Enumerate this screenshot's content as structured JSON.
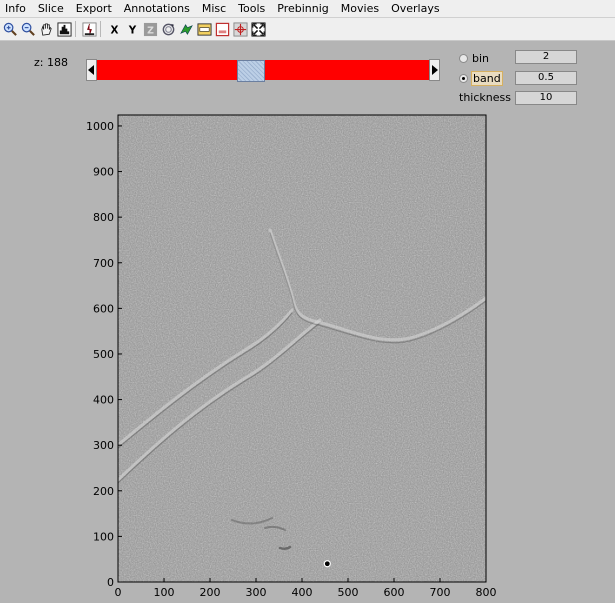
{
  "menu": [
    "Info",
    "Slice",
    "Export",
    "Annotations",
    "Misc",
    "Tools",
    "Prebinnig",
    "Movies",
    "Overlays"
  ],
  "toolbar": {
    "icons": [
      "zoom-in-icon",
      "zoom-out-icon",
      "pan-hand-icon",
      "histogram-icon",
      "contrast-icon",
      "x-axis-icon",
      "y-axis-icon",
      "z-axis-icon",
      "rotate-icon",
      "transform-icon",
      "window-icon",
      "box-icon",
      "crosshair-icon",
      "fit-icon"
    ],
    "x_label": "X",
    "y_label": "Y",
    "z_label": "Z"
  },
  "slice": {
    "z_label": "z: 188",
    "slider_position_fraction": 0.46,
    "track_color": "#ff0000"
  },
  "filter": {
    "bin_label": "bin",
    "band_label": "band",
    "selected": "band",
    "bin_value": "2",
    "band_value": "0.5",
    "thickness_label": "thickness",
    "thickness_value": "10"
  },
  "chart_data": {
    "type": "heatmap",
    "x_ticks": [
      "0",
      "100",
      "200",
      "300",
      "400",
      "500",
      "600",
      "700",
      "800"
    ],
    "y_ticks": [
      "0",
      "100",
      "200",
      "300",
      "400",
      "500",
      "600",
      "700",
      "800",
      "900",
      "1000"
    ],
    "xlim": [
      0,
      800
    ],
    "ylim": [
      0,
      1024
    ],
    "marker": {
      "x": 455,
      "y": 40
    }
  }
}
